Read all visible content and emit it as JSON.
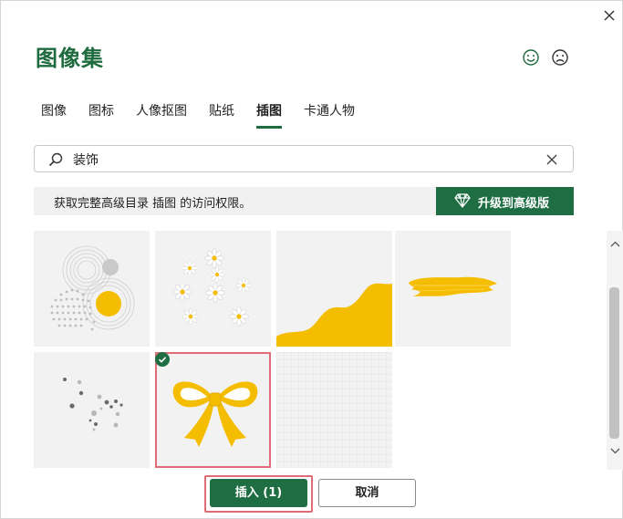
{
  "dialog": {
    "title": "图像集",
    "close_icon": "close-icon",
    "feedback_positive_icon": "smile-icon",
    "feedback_negative_icon": "frown-icon"
  },
  "tabs": [
    {
      "label": "图像"
    },
    {
      "label": "图标"
    },
    {
      "label": "人像抠图"
    },
    {
      "label": "贴纸"
    },
    {
      "label": "插图",
      "active": true
    },
    {
      "label": "卡通人物"
    }
  ],
  "search": {
    "value": "装饰",
    "placeholder": "",
    "search_icon": "search-icon",
    "clear_icon": "clear-icon"
  },
  "banner": {
    "text": "获取完整高级目录 插图 的访问权限。",
    "upgrade_label": "升级到高级版",
    "upgrade_icon": "diamond-icon"
  },
  "gallery": {
    "items": [
      {
        "name": "concentric-circles-dots-illustration",
        "selected": false
      },
      {
        "name": "daisies-illustration",
        "selected": false
      },
      {
        "name": "yellow-wave-corner-illustration",
        "selected": false
      },
      {
        "name": "yellow-brush-stroke-illustration",
        "selected": false
      },
      {
        "name": "scattered-dots-illustration",
        "selected": false
      },
      {
        "name": "yellow-bow-illustration",
        "selected": true
      },
      {
        "name": "grid-pattern-illustration",
        "selected": false
      }
    ]
  },
  "colors": {
    "brand_green": "#1f6e43",
    "accent_yellow": "#f5bd00",
    "selection_red": "#e06d76"
  },
  "footer": {
    "insert_label": "插入 (1)",
    "cancel_label": "取消"
  }
}
